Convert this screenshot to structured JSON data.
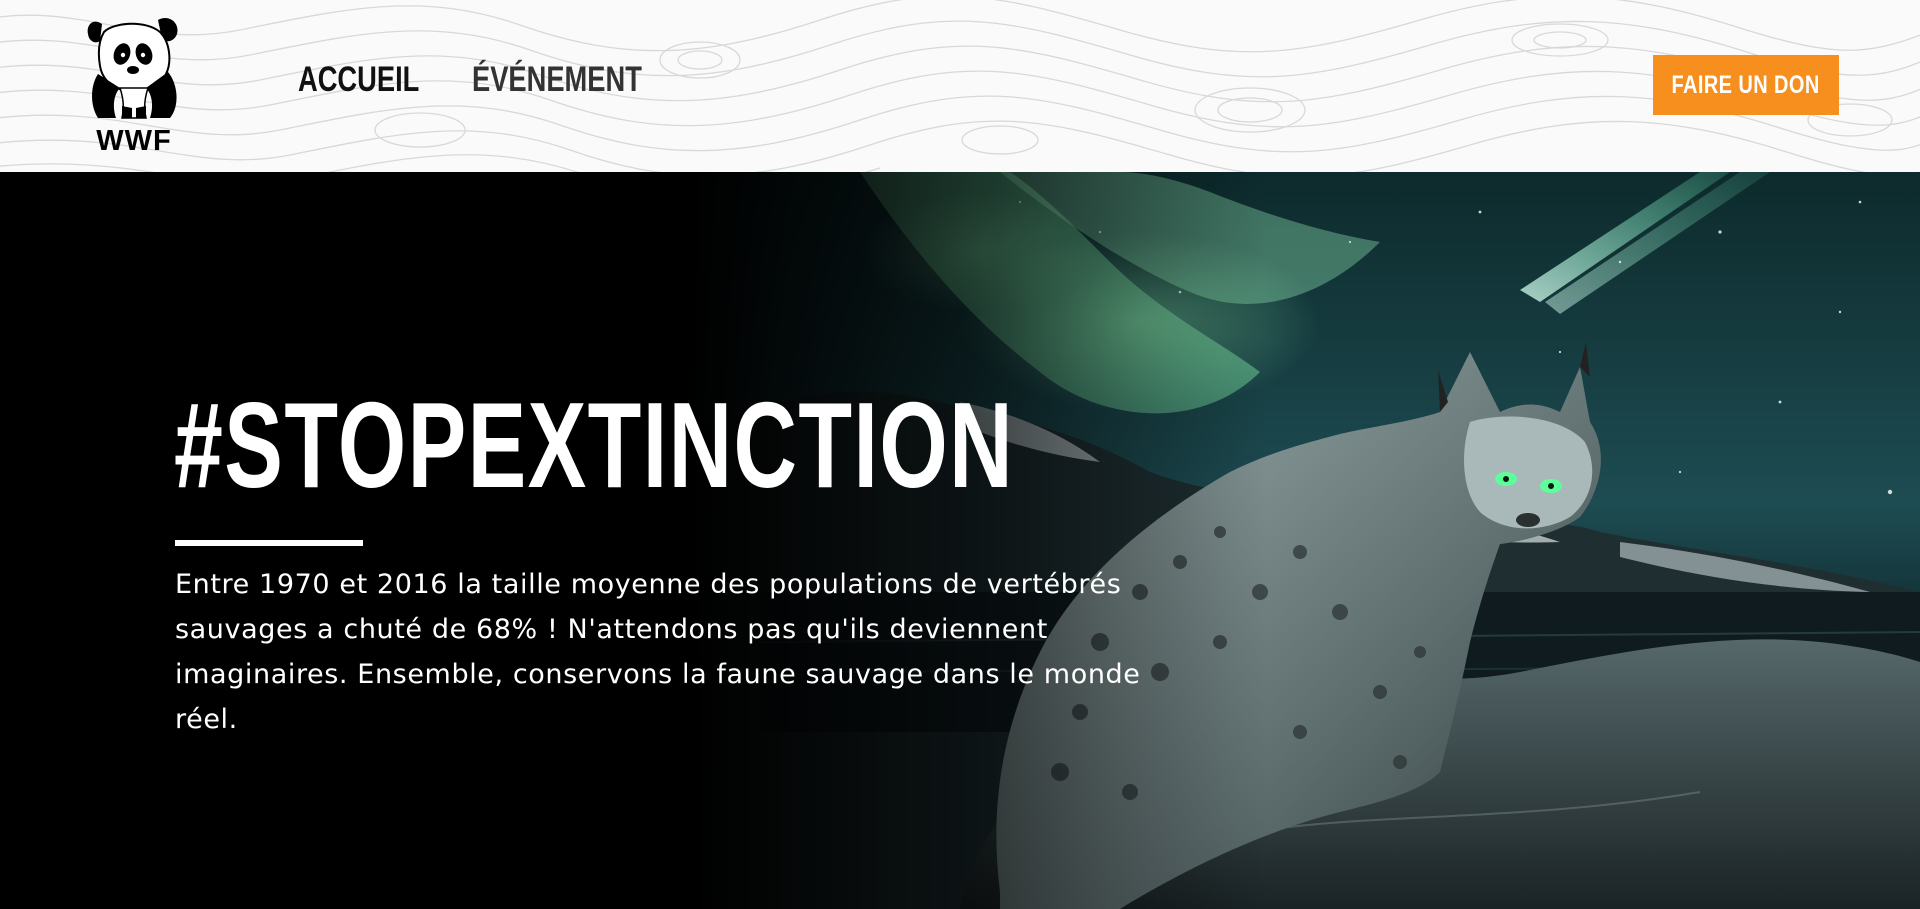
{
  "header": {
    "logo_text": "WWF",
    "nav": [
      {
        "label": "ACCUEIL"
      },
      {
        "label": "ÉVÉNEMENT"
      }
    ],
    "donate_label": "FAIRE UN DON",
    "accent_color": "#f78f1e"
  },
  "hero": {
    "title": "#STOPEXTINCTION",
    "text": "Entre 1970 et 2016 la taille moyenne des populations de vertébrés sauvages a chuté de 68% ! N'attendons pas qu'ils deviennent imaginaires. Ensemble, conservons la faune sauvage dans le monde réel.",
    "image_subject": "lynx-with-glowing-eyes-aurora"
  }
}
